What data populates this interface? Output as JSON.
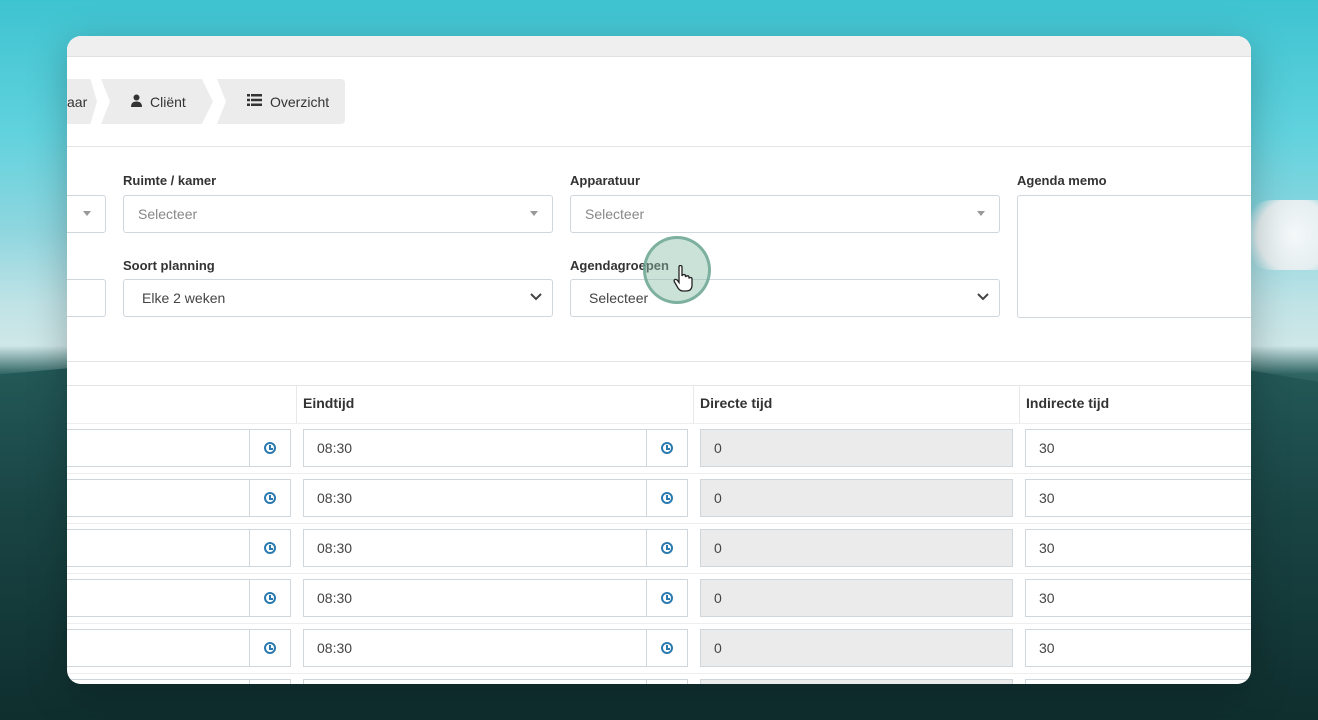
{
  "wizard": {
    "steps": [
      {
        "label": "aar",
        "icon": ""
      },
      {
        "label": "Cliënt",
        "icon": "user-icon"
      },
      {
        "label": "Overzicht",
        "icon": "list-icon"
      }
    ]
  },
  "form": {
    "ruimte_label": "Ruimte / kamer",
    "ruimte_placeholder": "Selecteer",
    "apparatuur_label": "Apparatuur",
    "apparatuur_placeholder": "Selecteer",
    "agenda_memo_label": "Agenda memo",
    "soort_planning_label": "Soort planning",
    "soort_planning_value": "Elke 2 weken",
    "agendagroepen_label": "Agendagroepen",
    "agendagroepen_value": "Selecteer"
  },
  "table": {
    "columns": [
      "Eindtijd",
      "Directe tijd",
      "Indirecte tijd"
    ],
    "rows": [
      {
        "eindtijd": "08:30",
        "directe_tijd": "0",
        "indirecte_tijd": "30"
      },
      {
        "eindtijd": "08:30",
        "directe_tijd": "0",
        "indirecte_tijd": "30"
      },
      {
        "eindtijd": "08:30",
        "directe_tijd": "0",
        "indirecte_tijd": "30"
      },
      {
        "eindtijd": "08:30",
        "directe_tijd": "0",
        "indirecte_tijd": "30"
      },
      {
        "eindtijd": "08:30",
        "directe_tijd": "0",
        "indirecte_tijd": "30"
      }
    ]
  },
  "colors": {
    "accent": "#2a7ab0",
    "readonly_bg": "#ebebeb"
  }
}
